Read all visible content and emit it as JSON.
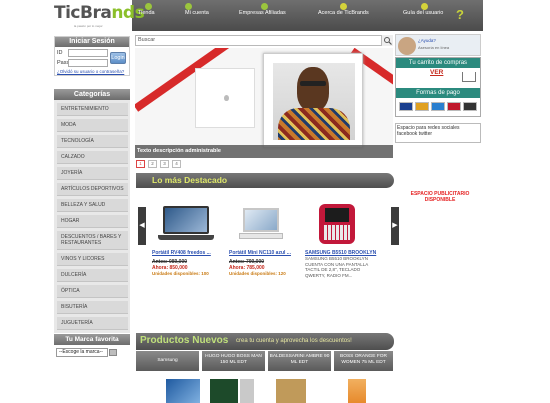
{
  "logo": {
    "text_a": "TicBra",
    "text_b": "nds",
    "tagline": "la pasión por lo mejor"
  },
  "nav": [
    {
      "label": "Tienda"
    },
    {
      "label": "Mi cuenta"
    },
    {
      "label": "Empresas Afiliadas"
    },
    {
      "label": "Acerca de TicBrands"
    },
    {
      "label": "Guía del usuario"
    }
  ],
  "help_glyph": "?",
  "login": {
    "title": "Iniciar Sesión",
    "id_label": "ID",
    "pass_label": "Pass",
    "button": "Login",
    "forgot": "¿Olvidó su usuario o contraseña?"
  },
  "categories": {
    "title": "Categorías",
    "items": [
      "ENTRETENIMIENTO",
      "MODA",
      "TECNOLOGÍA",
      "CALZADO",
      "JOYERÍA",
      "ARTÍCULOS DEPORTIVOS",
      "BELLEZA Y SALUD",
      "HOGAR",
      "DESCUENTOS / BARES Y RESTAURANTES",
      "VINOS Y LICORES",
      "DULCERÍA",
      "ÓPTICA",
      "BISUTERÍA",
      "JUGUETERÍA",
      "PERFUMERÍA"
    ]
  },
  "favorite_brand": {
    "title": "Tu Marca favorita",
    "select_value": "--Escoge la marca--"
  },
  "search": {
    "placeholder": "Buscar"
  },
  "banner": {
    "caption": "Texto descripción administrable"
  },
  "pager": [
    "1",
    "2",
    "3",
    "4"
  ],
  "destacado": {
    "title": "Lo más Destacado"
  },
  "carousel": {
    "prev": "◀",
    "next": "▶"
  },
  "products": [
    {
      "name": "Portátil RV408 freedos ...",
      "old": "Antes: 989,000",
      "now": "Ahora: 850,000",
      "units": "Unidades disponibles: 100"
    },
    {
      "name": "Portátil Mini NC110 azul ...",
      "old": "Antes: 799,000",
      "now": "Ahora: 785,000",
      "units": "Unidades disponibles: 120"
    },
    {
      "name": "SAMSUNG B5510 BROOKLYN",
      "desc": "SAMSUNG B5510 BROOKLYN CUENTA CON UNA PANTALLA TACTIL DE 2,8\", TECLADO QWERTY, RADIO FM..."
    }
  ],
  "chat": {
    "title": "¿Ayuda?",
    "subtitle": "Asesoría en línea"
  },
  "cart": {
    "title": "Tu carrito de compras",
    "view": "VER",
    "payments": "Formas de pago"
  },
  "payment_colors": [
    "#1a3f8f",
    "#e0a020",
    "#2a7fcf",
    "#c0182c",
    "#333333"
  ],
  "social": {
    "text": "Espacio para redes sociales facebook twitter"
  },
  "promo": {
    "text": "ESPACIO PUBLICITARIO DISPONIBLE"
  },
  "nuevos": {
    "title": "Productos Nuevos",
    "subtitle": "crea tu cuenta y aprovecha los descuentos!"
  },
  "tabs": [
    "Samsung",
    "HUGO HUGO BOSS MAN 150 ML EDT",
    "BALDESSARINI AMBRE 90 ML EDT",
    "BOSS ORANGE FOR WOMEN 75 ML EDT"
  ]
}
